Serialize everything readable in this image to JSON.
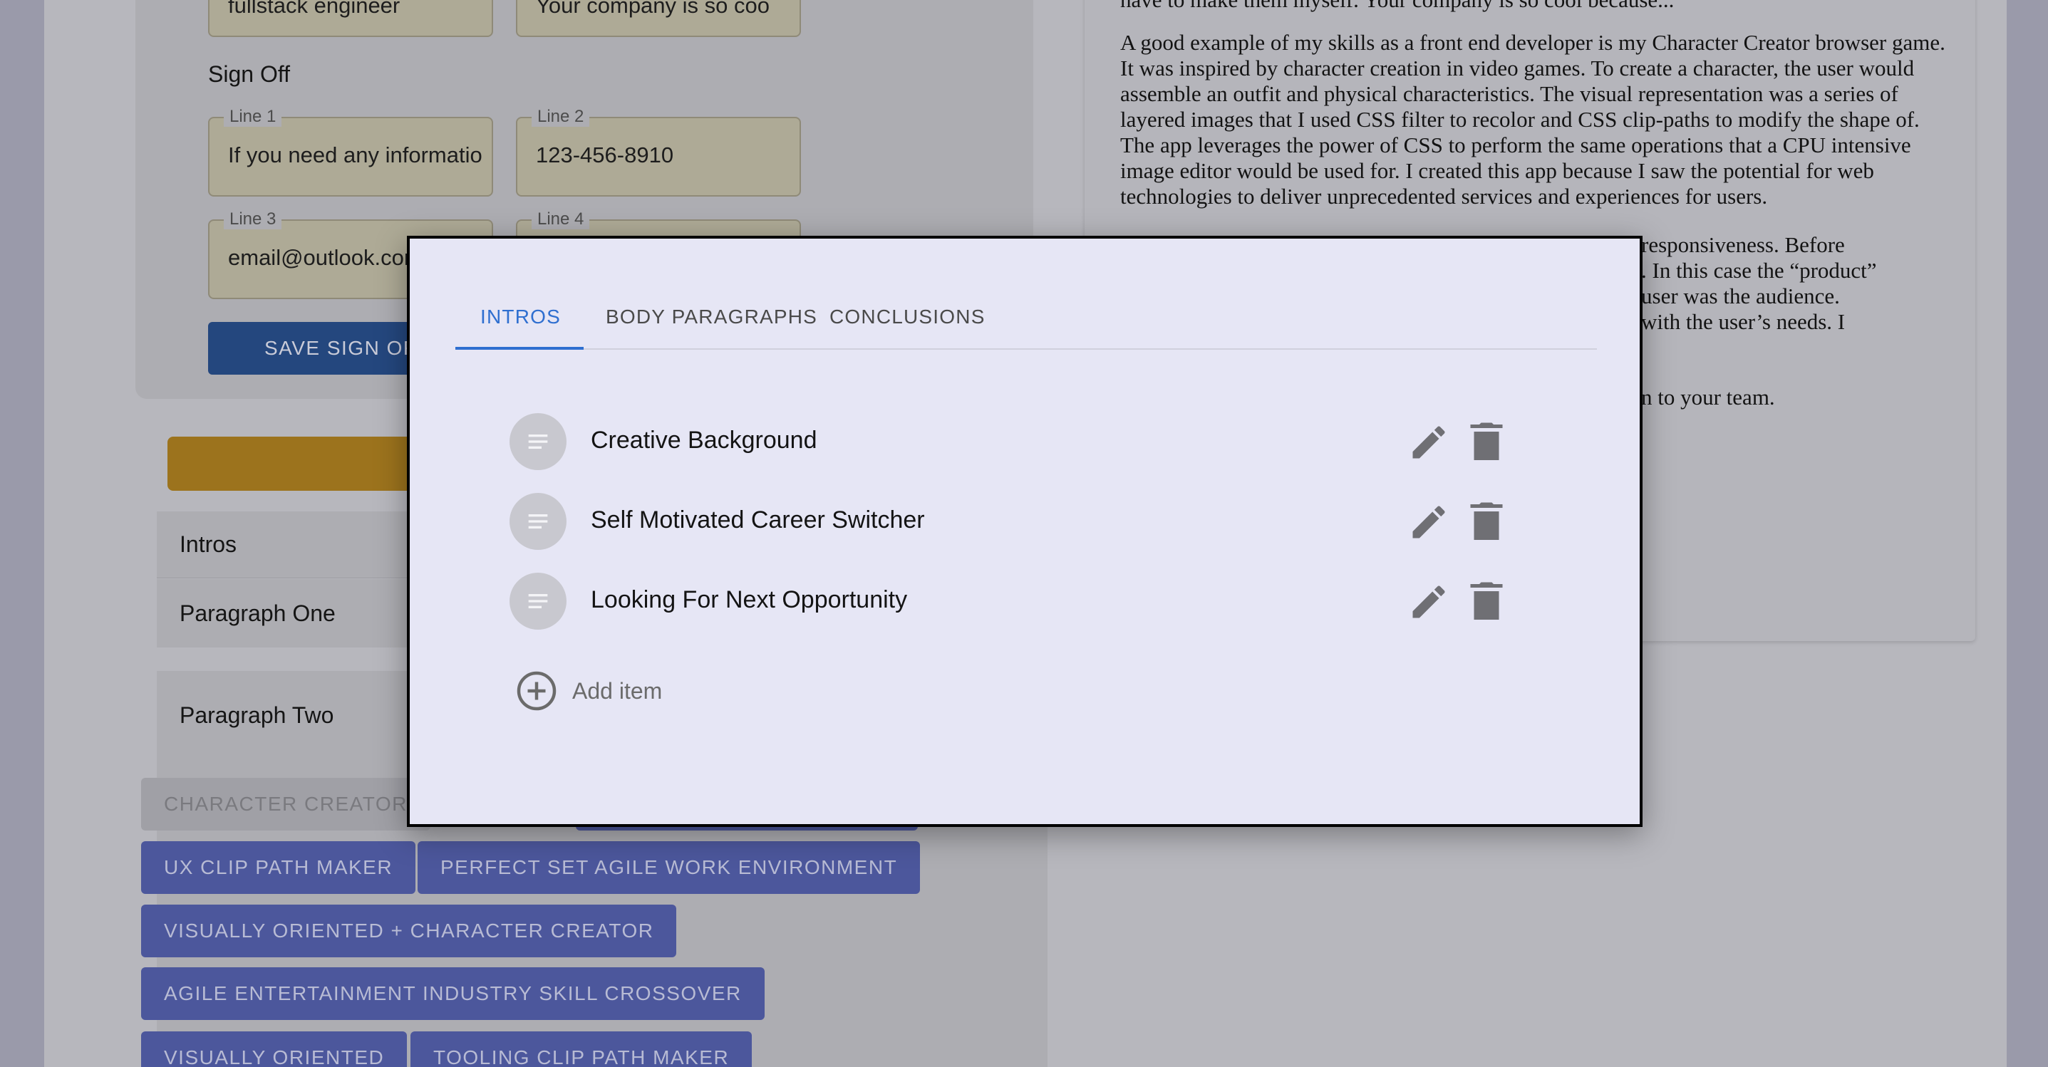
{
  "form": {
    "top_values": [
      "fullstack engineer",
      "Your company is so coo"
    ],
    "sign_off_title": "Sign Off",
    "fields": [
      {
        "label": "Line 1",
        "value": "If you need any information"
      },
      {
        "label": "Line 2",
        "value": "123-456-8910"
      },
      {
        "label": "Line 3",
        "value": "email@outlook.com"
      },
      {
        "label": "Line 4",
        "value": ""
      }
    ],
    "save_button": "SAVE SIGN OFF"
  },
  "accordion": {
    "intros": "Intros",
    "paragraph_one": "Paragraph One",
    "paragraph_two": "Paragraph Two"
  },
  "chips": [
    "CHARACTER CREATOR",
    "UX CLIP PATH MAKER",
    "PERFECT SET AGILE WORK ENVIRONMENT",
    "VISUALLY ORIENTED + CHARACTER CREATOR",
    "AGILE ENTERTAINMENT INDUSTRY SKILL CROSSOVER",
    "VISUALLY ORIENTED",
    "TOOLING CLIP PATH MAKER"
  ],
  "letter": {
    "top_line": "have to make them myself. Your company is so cool because...",
    "paragraph_1": "A good example of my skills as a front end developer is my Character Creator browser game. It was inspired by character creation in video games. To create a character, the user would assemble an outfit and physical characteristics. The visual representation was a series of layered images that I used CSS filter to recolor and CSS clip-paths to modify the shape of. The app leverages the power of CSS to perform the same operations that a CPU intensive image editor would be used for. I created this app because I saw the potential for web technologies to deliver unprecedented services and experiences for users.",
    "paragraph_2_fragments": [
      "responsiveness. Before",
      ". In this case the “product”",
      "user was the audience.",
      "with the user’s needs. I"
    ],
    "paragraph_3_fragment": "n to your team."
  },
  "modal": {
    "tabs": [
      "INTROS",
      "BODY PARAGRAPHS",
      "CONCLUSIONS"
    ],
    "active_tab": "INTROS",
    "items": [
      "Creative Background",
      "Self Motivated Career Switcher",
      "Looking For Next Opportunity"
    ],
    "add_item_label": "Add item"
  },
  "colors": {
    "accent_blue": "#2f6fd0",
    "modal_bg": "#e6e6f5",
    "chip_bg": "#4c579c",
    "save_button_bg": "#24477e"
  },
  "icons": [
    "notes-icon",
    "edit-pencil-icon",
    "trash-icon",
    "add-circle-icon"
  ]
}
